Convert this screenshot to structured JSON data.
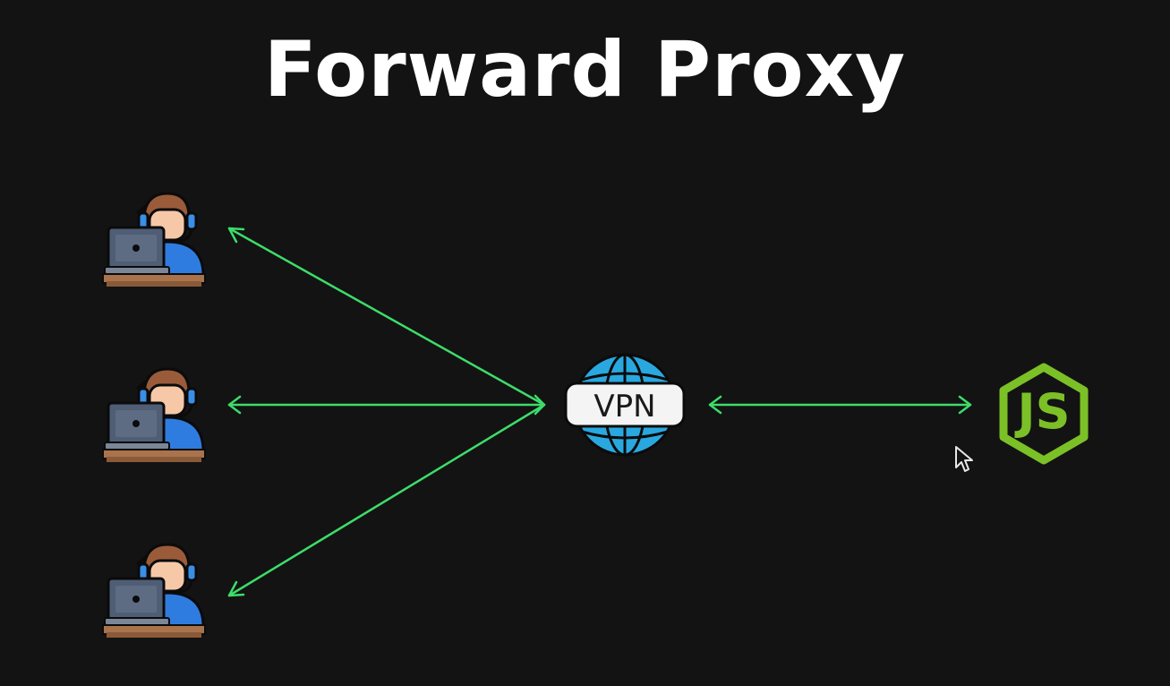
{
  "title": "Forward Proxy",
  "proxy_label": "VPN",
  "server_label": "JS",
  "clients": [
    {
      "icon": "client-user-at-laptop-icon"
    },
    {
      "icon": "client-user-at-laptop-icon"
    },
    {
      "icon": "client-user-at-laptop-icon"
    }
  ],
  "colors": {
    "background": "#131313",
    "arrow": "#3ddc6a",
    "globe": "#29a8e0",
    "nodejs": "#7cc027"
  }
}
